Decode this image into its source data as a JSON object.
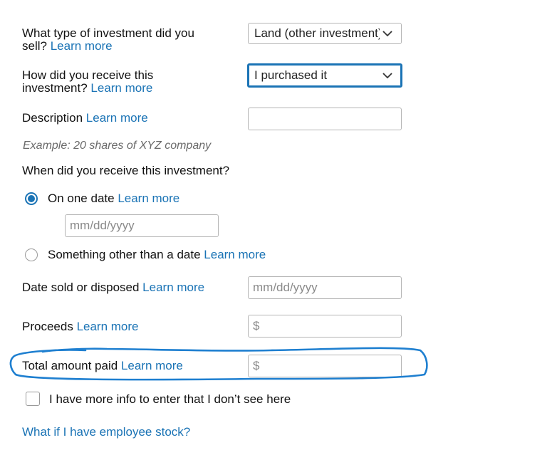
{
  "learn_more": "Learn more",
  "investment_type": {
    "label_line1": "What type of investment did you",
    "label_line2": "sell?",
    "selected": "Land (other investment)"
  },
  "receive_method": {
    "label_line1": "How did you receive this",
    "label_line2": "investment?",
    "selected": "I purchased it"
  },
  "description": {
    "label": "Description",
    "value": "",
    "example": "Example: 20 shares of XYZ company"
  },
  "when_received": {
    "question": "When did you receive this investment?",
    "option_one_date": "On one date",
    "date_placeholder": "mm/dd/yyyy",
    "option_other": "Something other than a date"
  },
  "date_sold": {
    "label": "Date sold or disposed",
    "placeholder": "mm/dd/yyyy"
  },
  "proceeds": {
    "label": "Proceeds",
    "currency_symbol": "$"
  },
  "total_paid": {
    "label": "Total amount paid",
    "currency_symbol": "$"
  },
  "more_info": {
    "label": "I have more info to enter that I don’t see here"
  },
  "employee_stock_link": "What if I have employee stock?",
  "colors": {
    "link": "#1a73b5",
    "annotation": "#1e7fd0"
  }
}
